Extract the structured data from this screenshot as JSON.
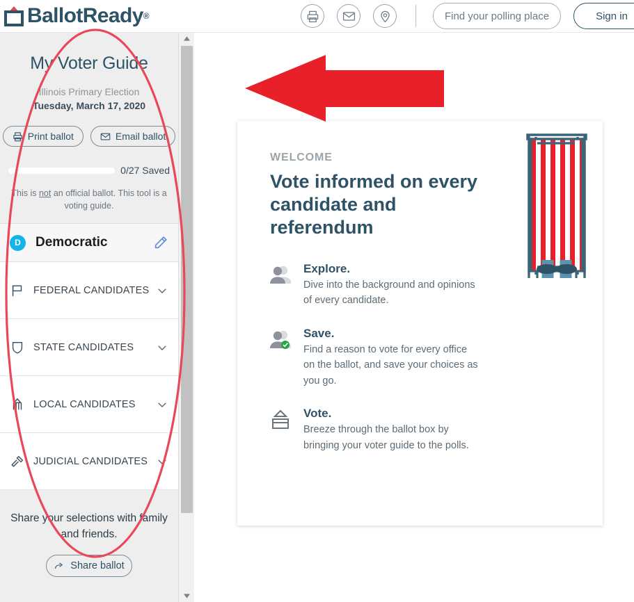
{
  "header": {
    "brand_name": "BallotReady",
    "brand_registered": "®",
    "icons": [
      {
        "name": "print-icon",
        "label": "Print"
      },
      {
        "name": "email-icon",
        "label": "Email"
      },
      {
        "name": "location-pin-icon",
        "label": "Polling location"
      }
    ],
    "find_polling_place_label": "Find your polling place",
    "sign_in_label": "Sign in"
  },
  "sidebar": {
    "title": "My Voter Guide",
    "election_name": "Illinois Primary Election",
    "election_date": "Tuesday, March 17, 2020",
    "print_ballot_label": "Print ballot",
    "email_ballot_label": "Email ballot",
    "saved_label": "0/27 Saved",
    "saved_count": 0,
    "saved_total": 27,
    "progress_percent": 0,
    "disclaimer_pre": "This is ",
    "disclaimer_emphasis": "not",
    "disclaimer_post": " an official ballot. This tool is a voting guide.",
    "party": {
      "badge": "D",
      "name": "Democratic",
      "badge_color": "#12b5ea",
      "edit_icon": "pencil-icon"
    },
    "categories": [
      {
        "label": "FEDERAL CANDIDATES",
        "icon": "flag-icon",
        "expanded": false
      },
      {
        "label": "STATE CANDIDATES",
        "icon": "shield-icon",
        "expanded": false
      },
      {
        "label": "LOCAL CANDIDATES",
        "icon": "capitol-building-icon",
        "expanded": false
      },
      {
        "label": "JUDICIAL CANDIDATES",
        "icon": "gavel-icon",
        "expanded": false
      }
    ],
    "share_text": "Share your selections with family and friends.",
    "share_button_label": "Share ballot"
  },
  "scrollbar": {
    "up_arrow": "scroll-up-arrow-icon",
    "down_arrow": "scroll-down-arrow-icon"
  },
  "main": {
    "card": {
      "eyebrow": "WELCOME",
      "headline": "Vote informed on every candidate and referendum",
      "features": [
        {
          "icon": "person-icon",
          "title": "Explore.",
          "description": "Dive into the background and opinions of every candidate."
        },
        {
          "icon": "person-check-icon",
          "title": "Save.",
          "description": "Find a reason to vote for every office on the ballot, and save your choices as you go."
        },
        {
          "icon": "ballot-box-icon",
          "title": "Vote.",
          "description": "Breeze through the ballot box by bringing your voter guide to the polls."
        }
      ],
      "illustration": "voting-booth-illustration"
    }
  },
  "annotations": {
    "arrow": {
      "name": "red-arrow-annotation",
      "color": "#e8202a",
      "direction": "left"
    },
    "ellipse": {
      "name": "red-ellipse-annotation",
      "color": "#e8485a"
    }
  },
  "colors": {
    "brand_navy": "#2e5266",
    "annotation_red": "#e8202a",
    "sidebar_bg": "#eeeeee",
    "accent_blue": "#12b5ea"
  }
}
